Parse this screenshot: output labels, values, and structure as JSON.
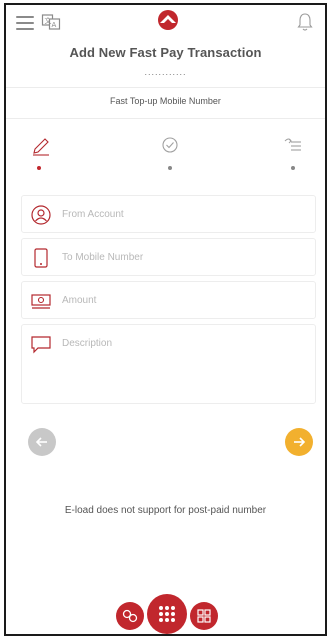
{
  "header": {
    "title": "Add New Fast Pay Transaction",
    "dots": "............",
    "subtitle": "Fast Top-up Mobile Number",
    "menu_icon": "hamburger-icon",
    "language_icon": "translate-icon",
    "logo_icon": "app-logo",
    "notification_icon": "bell-icon"
  },
  "steps": [
    {
      "icon": "pencil-icon",
      "active": true
    },
    {
      "icon": "check-shield-icon",
      "active": false
    },
    {
      "icon": "list-arrow-icon",
      "active": false
    }
  ],
  "form": {
    "from_account_placeholder": "From Account",
    "to_mobile_placeholder": "To Mobile Number",
    "amount_placeholder": "Amount",
    "description_placeholder": "Description"
  },
  "note": "E-load does not support for post-paid number",
  "colors": {
    "brand_red": "#c1272d",
    "next_orange": "#f2b02e",
    "prev_gray": "#c8c8c8"
  }
}
